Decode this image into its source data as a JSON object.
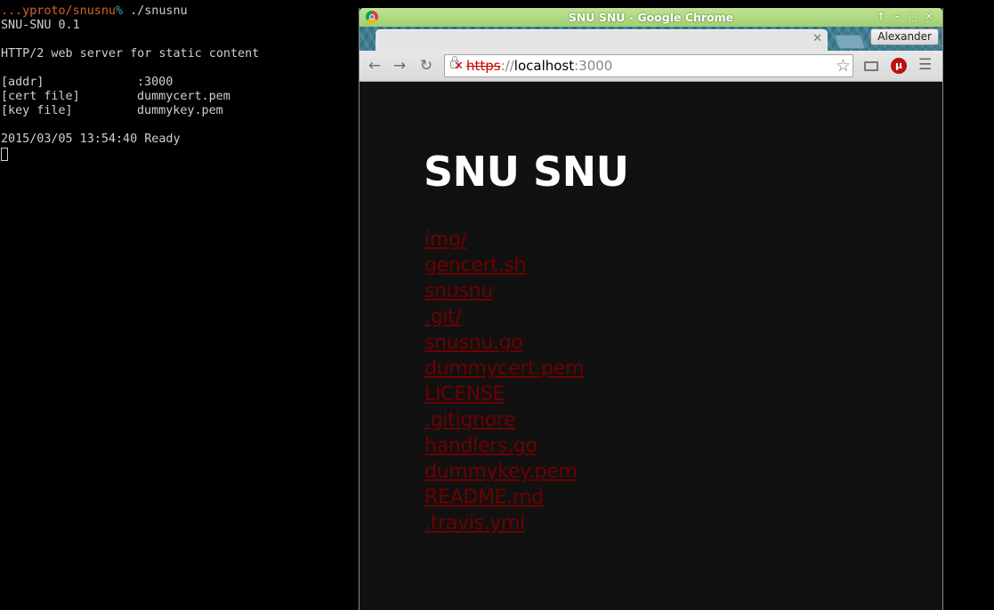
{
  "terminal": {
    "prompt_path": "...yproto/snusnu",
    "prompt_symbol": "%",
    "command": " ./snusnu",
    "banner": "SNU-SNU 0.1",
    "description": "HTTP/2 web server for static content",
    "config": [
      {
        "key": "[addr]",
        "value": ":3000"
      },
      {
        "key": "[cert file]",
        "value": "dummycert.pem"
      },
      {
        "key": "[key file]",
        "value": "dummykey.pem"
      }
    ],
    "status": "2015/03/05 13:54:40 Ready"
  },
  "browser": {
    "window_title": "SNU SNU - Google Chrome",
    "profile_name": "Alexander",
    "url": {
      "scheme": "https",
      "separator": "://",
      "host": "localhost",
      "port": ":3000"
    }
  },
  "page": {
    "title": "SNU SNU",
    "link_color": "#6e0000",
    "files": [
      "img/",
      "gencert.sh",
      "snusnu",
      ".git/",
      "snusnu.go",
      "dummycert.pem",
      "LICENSE",
      ".gitignore",
      "handlers.go",
      "dummykey.pem",
      "README.md",
      ".travis.yml"
    ]
  }
}
